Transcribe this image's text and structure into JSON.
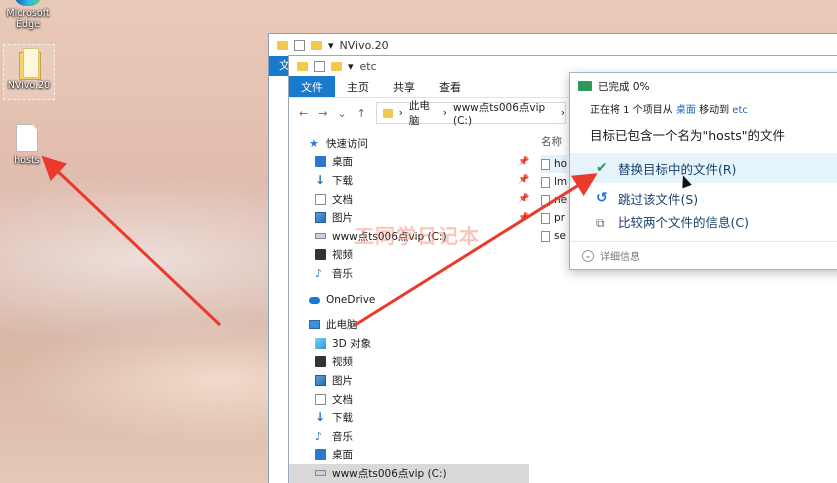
{
  "desktop": {
    "icons": [
      {
        "label": "Microsoft Edge"
      },
      {
        "label": "NVivo.20"
      },
      {
        "label": "hosts"
      }
    ]
  },
  "back_window": {
    "title": "NVivo.20",
    "tab_fragment": "文"
  },
  "explorer": {
    "title": "etc",
    "tabs": [
      "文件",
      "主页",
      "共享",
      "查看"
    ],
    "address": [
      "此电脑",
      "www点ts006点vip (C:)"
    ],
    "nav": {
      "quick_access": "快速访问",
      "quick_items": [
        "桌面",
        "下载",
        "文档",
        "图片",
        "www点ts006点vip (C:)",
        "视频",
        "音乐"
      ],
      "onedrive": "OneDrive",
      "this_pc": "此电脑",
      "pc_items": [
        "3D 对象",
        "视频",
        "图片",
        "文档",
        "下载",
        "音乐",
        "桌面",
        "www点ts006点vip (C:)"
      ]
    },
    "files": {
      "header": "名称",
      "rows": [
        "ho",
        "lm",
        "ne",
        "pr",
        "se"
      ]
    }
  },
  "dialog": {
    "title": "已完成 0%",
    "progress_prefix": "正在将 1 个项目从",
    "from": "桌面",
    "moving_to": "移动到",
    "to": "etc",
    "heading": "目标已包含一个名为\"hosts\"的文件",
    "options": [
      "替换目标中的文件(R)",
      "跳过该文件(S)",
      "比较两个文件的信息(C)"
    ],
    "details": "详细信息"
  },
  "watermark": "工同学日记本",
  "colors": {
    "accent": "#1979ca",
    "arrow": "#ea3a2c",
    "check": "#2c9a59"
  }
}
